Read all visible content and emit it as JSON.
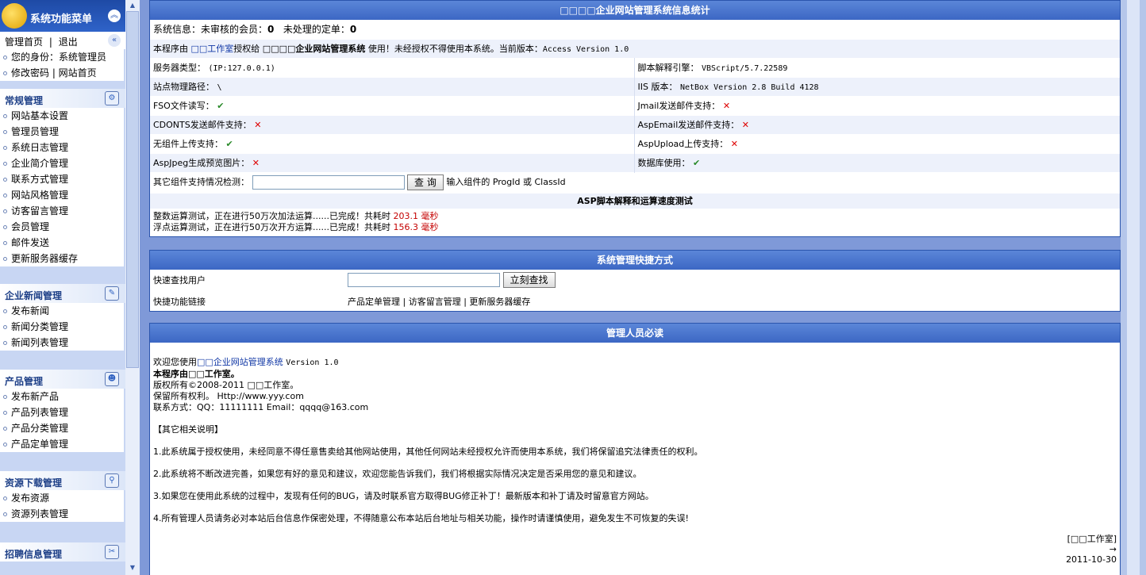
{
  "sidebar": {
    "header_title": "系统功能菜单",
    "top_links": [
      "管理首页",
      "|",
      "退出"
    ],
    "top_items": [
      "您的身份：系统管理员",
      "修改密码 | 网站首页"
    ],
    "sections": [
      {
        "title": "常规管理",
        "icon": "gear-icon",
        "items": [
          "网站基本设置",
          "管理员管理",
          "系统日志管理",
          "企业简介管理",
          "联系方式管理",
          "网站风格管理",
          "访客留言管理",
          "会员管理",
          "邮件发送",
          "更新服务器缓存"
        ]
      },
      {
        "title": "企业新闻管理",
        "icon": "news-icon",
        "items": [
          "发布新闻",
          "新闻分类管理",
          "新闻列表管理"
        ]
      },
      {
        "title": "产品管理",
        "icon": "product-icon",
        "items": [
          "发布新产品",
          "产品列表管理",
          "产品分类管理",
          "产品定单管理"
        ]
      },
      {
        "title": "资源下载管理",
        "icon": "download-icon",
        "items": [
          "发布资源",
          "资源列表管理"
        ]
      },
      {
        "title": "招聘信息管理",
        "icon": "job-icon",
        "items": []
      }
    ]
  },
  "stats": {
    "title": "□□□□企业网站管理系统信息统计",
    "sysinfo": "系统信息：未审核的会员：",
    "unaudited_count": "0",
    "unhandled_label": "未处理的定单：",
    "unhandled_count": "0",
    "license_prefix": "本程序由",
    "license_studio": "□□工作室",
    "license_mid": "授权给",
    "license_system": "□□□□企业网站管理系统",
    "license_suffix": "使用！未经授权不得使用本系统。当前版本：",
    "version": "Access Version 1.0",
    "rows": [
      {
        "l_label": "服务器类型：",
        "l_value": "(IP:127.0.0.1)",
        "r_label": "脚本解释引擎：",
        "r_value": "VBScript/5.7.22589"
      },
      {
        "l_label": "站点物理路径：",
        "l_value": "\\",
        "r_label": "IIS 版本：",
        "r_value": "NetBox Version 2.8 Build 4128"
      },
      {
        "l_label": "FSO文件读写：",
        "l_mark": "✔",
        "l_ok": true,
        "r_label": "Jmail发送邮件支持：",
        "r_mark": "✕",
        "r_ok": false
      },
      {
        "l_label": "CDONTS发送邮件支持：",
        "l_mark": "✕",
        "l_ok": false,
        "r_label": "AspEmail发送邮件支持：",
        "r_mark": "✕",
        "r_ok": false
      },
      {
        "l_label": "无组件上传支持：",
        "l_mark": "✔",
        "l_ok": true,
        "r_label": "AspUpload上传支持：",
        "r_mark": "✕",
        "r_ok": false
      },
      {
        "l_label": "AspJpeg生成预览图片：",
        "l_mark": "✕",
        "l_ok": false,
        "r_label": "数据库使用：",
        "r_mark": "✔",
        "r_ok": true
      }
    ],
    "component_query_label": "其它组件支持情况检测：",
    "query_button": "查 询",
    "component_hint": "输入组件的 ProgId 或 ClassId",
    "speed_title": "ASP脚本解释和运算速度测试",
    "int_test": "整数运算测试，正在进行50万次加法运算......已完成！共耗时",
    "int_time": "203.1 毫秒",
    "float_test": "浮点运算测试，正在进行50万次开方运算......已完成！共耗时",
    "float_time": "156.3 毫秒"
  },
  "shortcuts": {
    "title": "系统管理快捷方式",
    "find_user_label": "快速查找用户",
    "find_button": "立刻查找",
    "links_label": "快捷功能链接",
    "links": [
      "产品定单管理",
      "访客留言管理",
      "更新服务器缓存"
    ]
  },
  "notice": {
    "title": "管理人员必读",
    "welcome_prefix": "欢迎您使用",
    "welcome_system": "□□企业网站管理系统",
    "welcome_version": "Version 1.0",
    "line2": "本程序由□□工作室。",
    "line3": "版权所有©2008-2011 □□工作室。",
    "line4": "保留所有权利。 Http://www.yyy.com",
    "line5": "联系方式：QQ：11111111 Email：qqqq@163.com",
    "other_title": "【其它相关说明】",
    "p1": "1.此系统属于授权使用，未经同意不得任意售卖给其他网站使用，其他任何网站未经授权允许而使用本系统，我们将保留追究法律责任的权利。",
    "p2": "2.此系统将不断改进完善，如果您有好的意见和建议，欢迎您能告诉我们，我们将根据实际情况决定是否采用您的意见和建议。",
    "p3": "3.如果您在使用此系统的过程中，发现有任何的BUG，请及时联系官方取得BUG修正补丁！最新版本和补丁请及时留意官方网站。",
    "p4": "4.所有管理人员请务必对本站后台信息作保密处理，不得随意公布本站后台地址与相关功能，操作时请谨慎使用，避免发生不可恢复的失误!",
    "signature": "[□□工作室]",
    "arrow": "→",
    "date": "2011-10-30"
  }
}
